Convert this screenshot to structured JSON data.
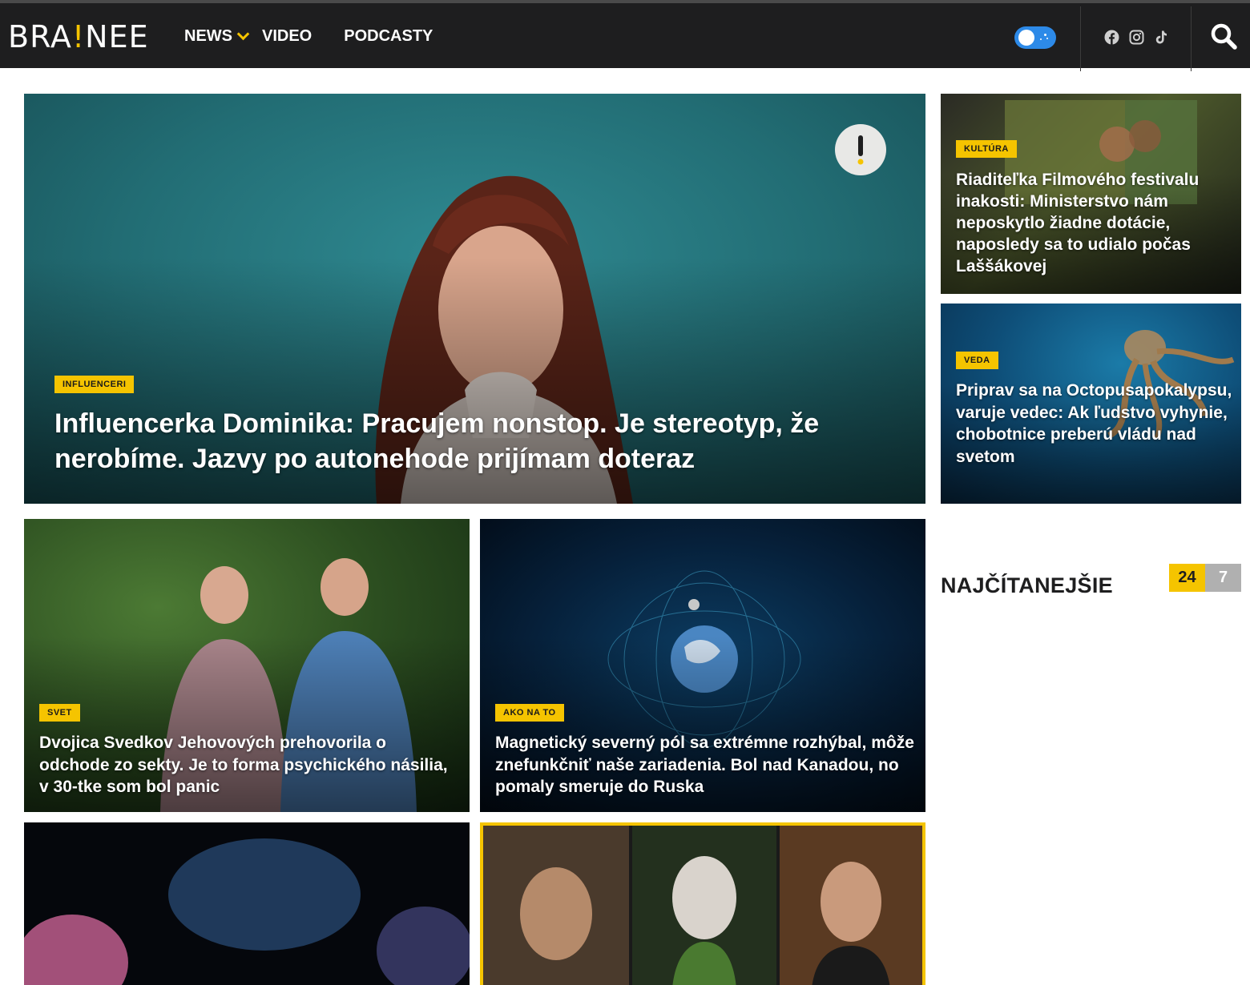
{
  "header": {
    "logo_prefix": "BRA",
    "logo_bang": "!",
    "logo_suffix": "NEE",
    "nav": [
      {
        "label": "NEWS"
      },
      {
        "label": "VIDEO"
      },
      {
        "label": "PODCASTY"
      }
    ],
    "theme_toggle_state": "on",
    "social_icons": [
      "facebook-icon",
      "instagram-icon",
      "tiktok-icon"
    ],
    "search_icon": "search-icon"
  },
  "main_article": {
    "tag": "INFLUENCERI",
    "title": "Influencerka Dominika: Pracujem nonstop. Je stereotyp, že nerobíme. Jazvy po autonehode prijímam doteraz",
    "badge_icon": "exclamation-icon"
  },
  "side_articles": [
    {
      "tag": "KULTÚRA",
      "title": "Riaditeľka Filmového festivalu inakosti: Ministerstvo nám neposkytlo žiadne dotácie, naposledy sa to udialo počas Laššákovej"
    },
    {
      "tag": "VEDA",
      "title": "Priprav sa na Octopusapokalypsu, varuje vedec: Ak ľudstvo vyhynie, chobotnice preberú vládu nad svetom"
    }
  ],
  "grid_articles": [
    {
      "tag": "SVET",
      "title": "Dvojica Svedkov Jehovových prehovorila o odchode zo sekty. Je to forma psychického násilia, v 30-tke som bol panic"
    },
    {
      "tag": "AKO NA TO",
      "title": "Magnetický severný pól sa extrémne rozhýbal, môže znefunkčniť naše zariadenia. Bol nad Kanadou, no pomaly smeruje do Ruska"
    }
  ],
  "most_read": {
    "heading": "NAJČÍTANEJŠIE",
    "tabs": [
      "24",
      "7"
    ],
    "active_tab": "24"
  },
  "colors": {
    "accent": "#f5c400",
    "header_bg": "#1e1e1f",
    "toggle": "#2d8ae8"
  }
}
